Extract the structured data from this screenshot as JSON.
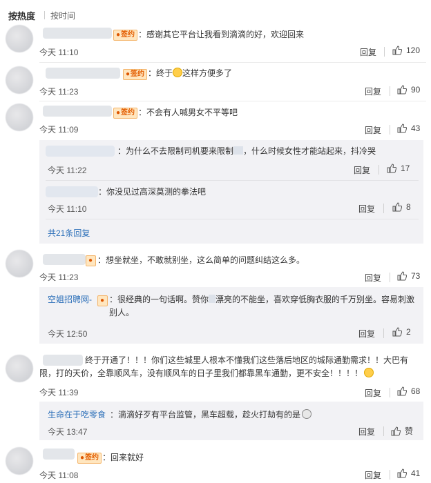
{
  "sort": {
    "hot": "按热度",
    "time": "按时间"
  },
  "comments": [
    {
      "text": "：感谢其它平台让我看到滴滴的好，欢迎回来",
      "time": "今天 11:10",
      "reply": "回复",
      "likes": "120"
    },
    {
      "text": "：终于",
      "text_after": "这样方便多了",
      "time": "今天 11:23",
      "reply": "回复",
      "likes": "90"
    },
    {
      "text": "：不会有人喊男女不平等吧",
      "time": "今天 11:09",
      "reply": "回复",
      "likes": "43"
    },
    {
      "text": "：想坐就坐，不敢就别坐，这么简单的问题纠结这么多。",
      "time": "今天 11:23",
      "reply": "回复",
      "likes": "73"
    },
    {
      "text": "终于开通了！！！你们这些城里人根本不懂我们这些落后地区的城际通勤需求！！大巴有限，打的天价，全靠顺风车，没有顺风车的日子里我们都靠黑车通勤，更不安全！！！！",
      "time": "今天 11:39",
      "reply": "回复",
      "likes": "68"
    },
    {
      "text": "：回来就好",
      "time": "今天 11:08",
      "reply": "回复",
      "likes": "41"
    }
  ],
  "replies": [
    {
      "text": "：为什么不去限制司机要来限制",
      "text2": "，什么时候女性才能站起来，抖冷哭",
      "time": "今天 11:22",
      "reply": "回复",
      "likes": "17"
    },
    {
      "text": "：你没见过高深莫测的拳法吧",
      "time": "今天 11:10",
      "reply": "回复",
      "likes": "8"
    },
    {
      "name": "空姐招聘网-",
      "text": "：很经典的一句话啊。赞你",
      "text2": "漂亮的不能坐，喜欢穿低胸衣服的千万别坐。容易刺激别人。",
      "time": "今天 12:50",
      "reply": "回复",
      "likes": "2"
    },
    {
      "name": "生命在于吃零食",
      "text": "：滴滴好歹有平台监管，黑车超载，趁火打劫有的是",
      "time": "今天 13:47",
      "reply": "回复",
      "likes": "赞"
    }
  ],
  "more_replies": "共21条回复",
  "badge_label": "签约",
  "colors": {
    "link": "#2a6eb8",
    "badge_bg": "#ffe6bf",
    "badge_fg": "#e35d00"
  },
  "icons": {
    "like": "thumbs-up-icon",
    "emoji": "smiley-emoji-icon"
  }
}
